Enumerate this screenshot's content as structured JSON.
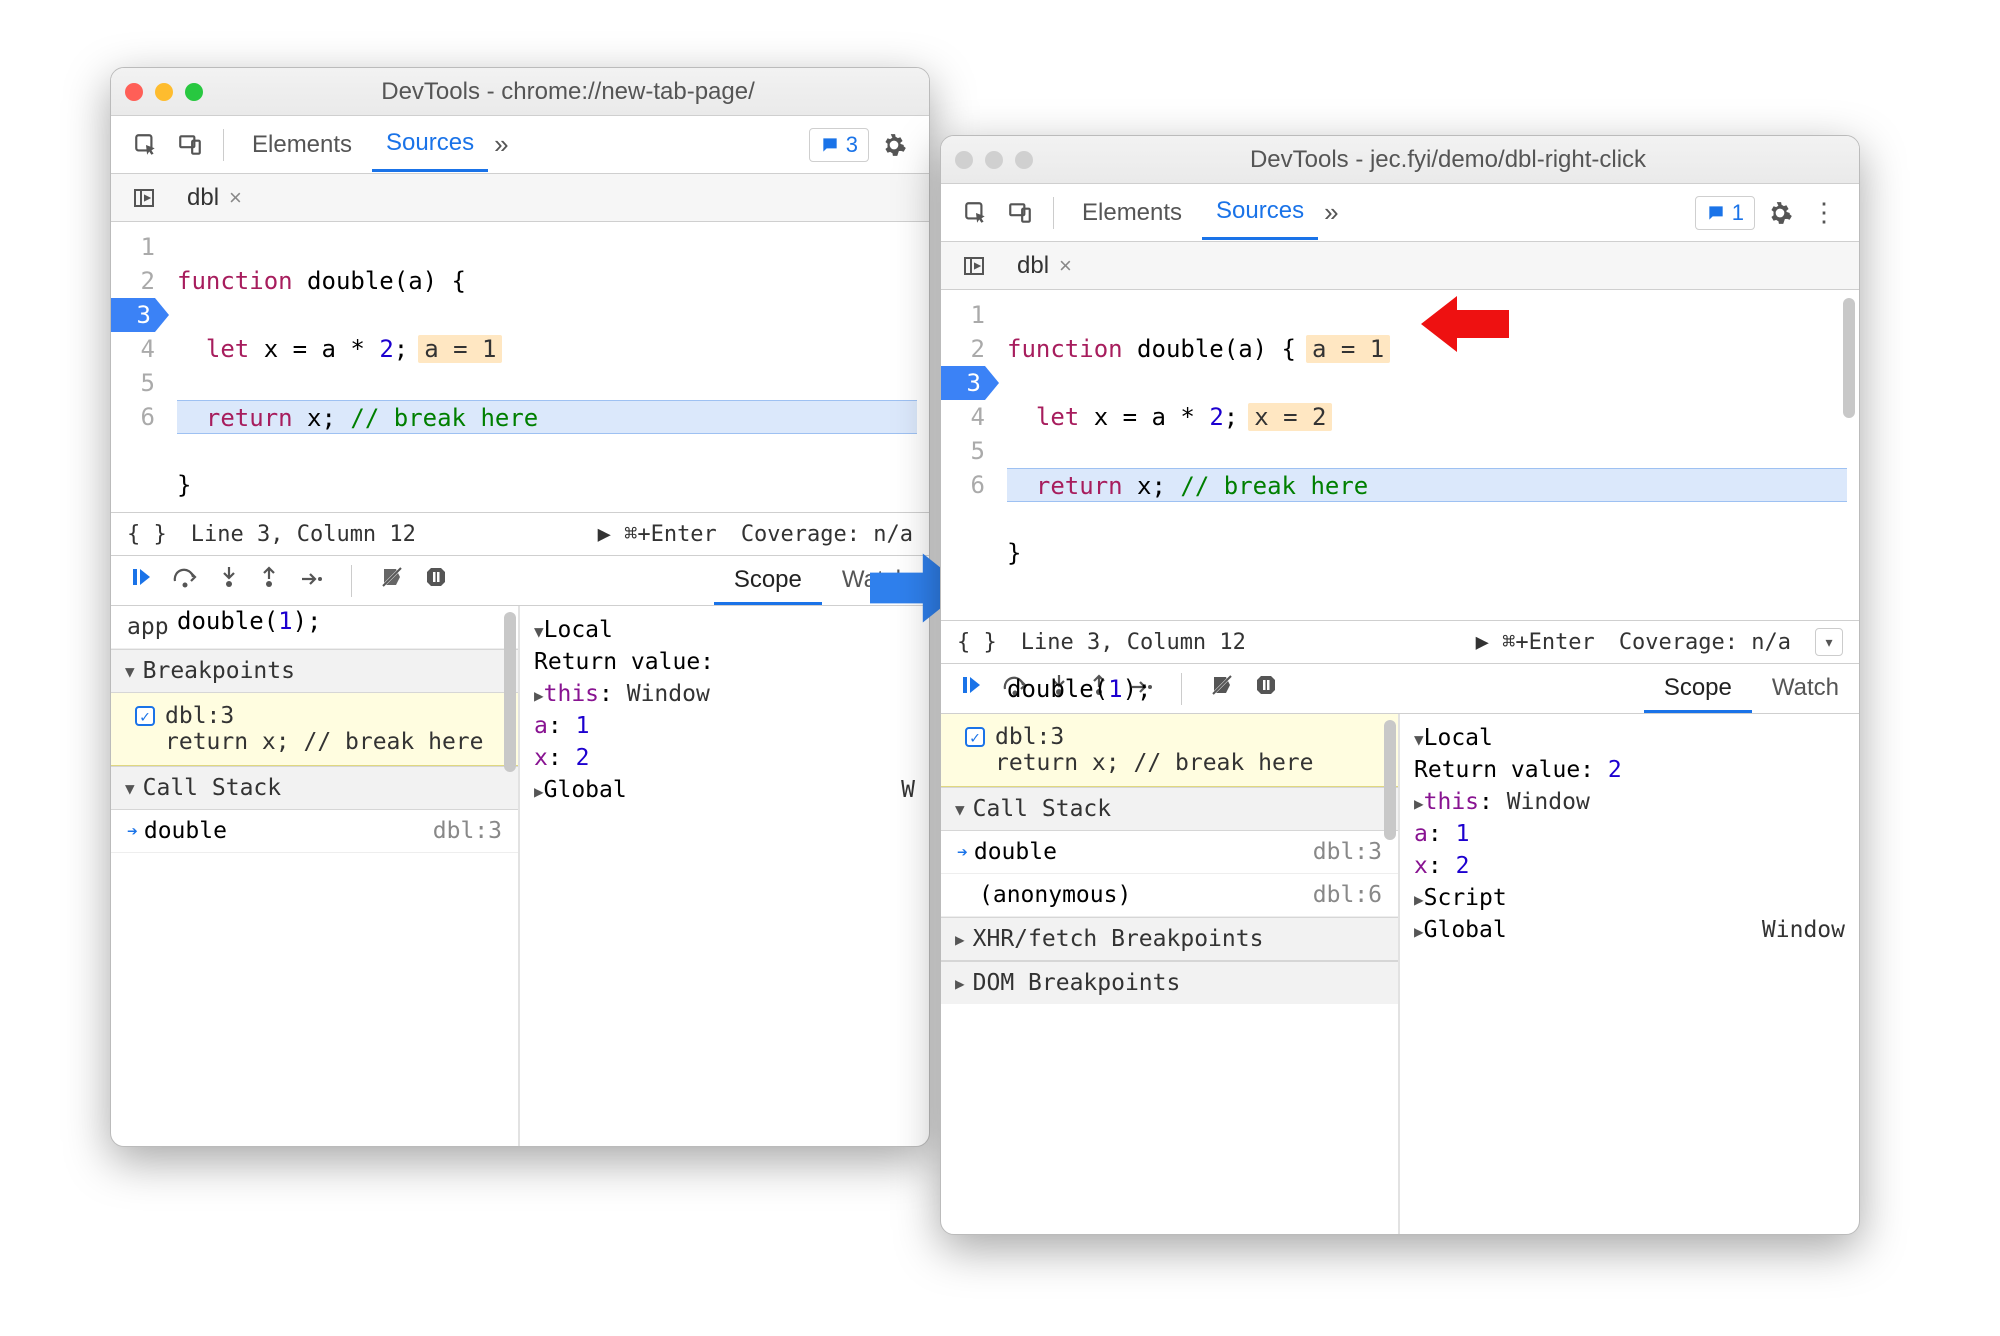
{
  "w1": {
    "title": "DevTools - chrome://new-tab-page/",
    "tabs": {
      "elements": "Elements",
      "sources": "Sources"
    },
    "issue_count": "3",
    "file_tab": "dbl",
    "code": {
      "l1a": "function",
      "l1b": " double(a) {",
      "l2a": "let",
      "l2b": " x = a * ",
      "l2c": "2",
      "l2d": ";",
      "l2_inline": "a = 1",
      "l3a": "return",
      "l3b": " x; ",
      "l3c": "// break here",
      "l4": "}",
      "l5": "",
      "l6a": "double(",
      "l6b": "1",
      "l6c": ");"
    },
    "status": {
      "linecol": "Line 3, Column 12",
      "run": "▶ ⌘+Enter",
      "cov": "Coverage: n/a"
    },
    "scope_tab": "Scope",
    "watch_tab": "Watch",
    "sect_app": "app",
    "sect_bp": "Breakpoints",
    "bp_label": "dbl:3",
    "bp_src": "return x; // break here",
    "sect_cs": "Call Stack",
    "cs_fn": "double",
    "cs_loc": "dbl:3",
    "scope": {
      "local": "Local",
      "retlabel": "Return value:",
      "this": "this",
      "thisv": "Window",
      "a": "a",
      "av": "1",
      "x": "x",
      "xv": "2",
      "global": "Global",
      "globalv": "W"
    }
  },
  "w2": {
    "title": "DevTools - jec.fyi/demo/dbl-right-click",
    "tabs": {
      "elements": "Elements",
      "sources": "Sources"
    },
    "issue_count": "1",
    "file_tab": "dbl",
    "code": {
      "l1a": "function",
      "l1b": " double(a) {",
      "l1_inline": "a = 1",
      "l2a": "let",
      "l2b": " x = a * ",
      "l2c": "2",
      "l2d": ";",
      "l2_inline": "x = 2",
      "l3a": "return",
      "l3b": " x; ",
      "l3c": "// break here",
      "l4": "}",
      "l5": "",
      "l6a": "double(",
      "l6b": "1",
      "l6c": ");"
    },
    "status": {
      "linecol": "Line 3, Column 12",
      "run": "▶ ⌘+Enter",
      "cov": "Coverage: n/a"
    },
    "scope_tab": "Scope",
    "watch_tab": "Watch",
    "bp_label": "dbl:3",
    "bp_src": "return x; // break here",
    "sect_cs": "Call Stack",
    "cs1_fn": "double",
    "cs1_loc": "dbl:3",
    "cs2_fn": "(anonymous)",
    "cs2_loc": "dbl:6",
    "sect_xhr": "XHR/fetch Breakpoints",
    "sect_dom": "DOM Breakpoints",
    "scope": {
      "local": "Local",
      "retlabel": "Return value:",
      "retv": "2",
      "this": "this",
      "thisv": "Window",
      "a": "a",
      "av": "1",
      "x": "x",
      "xv": "2",
      "script": "Script",
      "global": "Global",
      "globalv": "Window"
    }
  }
}
